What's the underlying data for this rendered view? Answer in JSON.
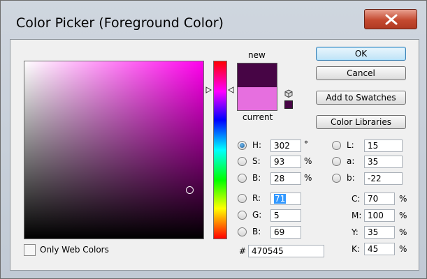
{
  "window": {
    "title": "Color Picker (Foreground Color)"
  },
  "colors": {
    "new": "#470545",
    "current": "#e66fdf",
    "hue_field": "#ff00ec"
  },
  "preview": {
    "new_label": "new",
    "current_label": "current"
  },
  "buttons": {
    "ok": "OK",
    "cancel": "Cancel",
    "add_to_swatches": "Add to Swatches",
    "color_libraries": "Color Libraries"
  },
  "hsb": [
    {
      "label": "H:",
      "value": "302",
      "unit": "°",
      "selected": true
    },
    {
      "label": "S:",
      "value": "93",
      "unit": "%"
    },
    {
      "label": "B:",
      "value": "28",
      "unit": "%"
    }
  ],
  "rgb": [
    {
      "label": "R:",
      "value": "71"
    },
    {
      "label": "G:",
      "value": "5"
    },
    {
      "label": "B:",
      "value": "69"
    }
  ],
  "lab": [
    {
      "label": "L:",
      "value": "15"
    },
    {
      "label": "a:",
      "value": "35"
    },
    {
      "label": "b:",
      "value": "-22"
    }
  ],
  "cmyk": [
    {
      "label": "C:",
      "value": "70",
      "unit": "%"
    },
    {
      "label": "M:",
      "value": "100",
      "unit": "%"
    },
    {
      "label": "Y:",
      "value": "35",
      "unit": "%"
    },
    {
      "label": "K:",
      "value": "45",
      "unit": "%"
    }
  ],
  "hex": {
    "label": "#",
    "value": "470545"
  },
  "web_colors": {
    "label": "Only Web Colors"
  }
}
